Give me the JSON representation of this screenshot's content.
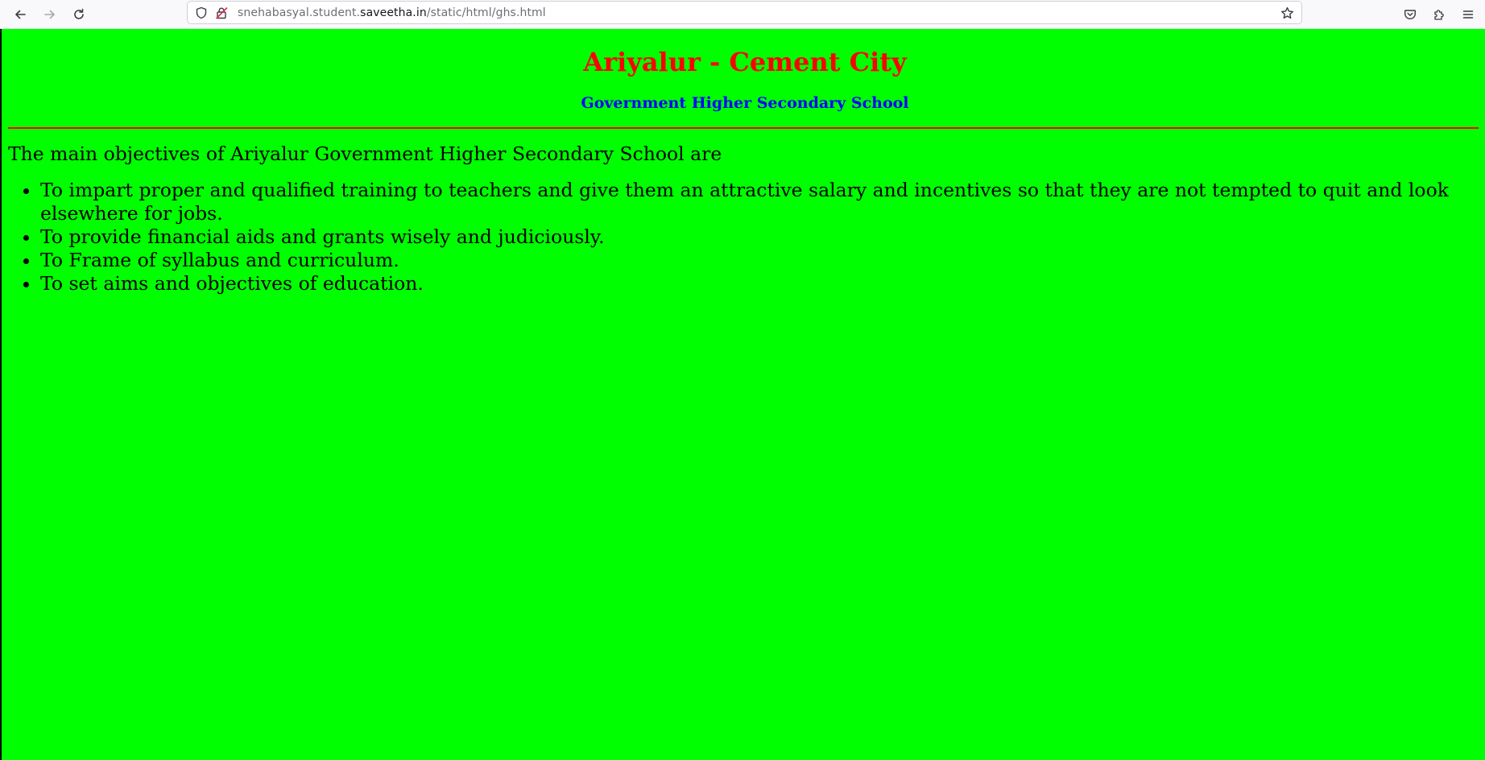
{
  "browser": {
    "url_prefix": "snehabasyal.student.",
    "url_domain": "saveetha.in",
    "url_path": "/static/html/ghs.html",
    "icons": {
      "back": "arrow-left-icon",
      "forward": "arrow-right-icon",
      "reload": "reload-icon",
      "site_info": "shield-icon",
      "connection": "insecure-lock-icon",
      "bookmark": "star-icon",
      "pocket": "pocket-icon",
      "extensions": "puzzle-icon",
      "menu": "hamburger-menu-icon"
    }
  },
  "page": {
    "background_color": "#00ff00",
    "heading": "Ariyalur - Cement City",
    "heading_color": "#ff0000",
    "subheading": "Government Higher Secondary School",
    "subheading_color": "#0000ff",
    "rule_color": "#ff0000",
    "intro": "The main objectives of Ariyalur Government Higher Secondary School are",
    "objectives": [
      "To impart proper and qualified training to teachers and give them an attractive salary and incentives so that they are not tempted to quit and look elsewhere for jobs.",
      "To provide financial aids and grants wisely and judiciously.",
      "To Frame of syllabus and curriculum.",
      "To set aims and objectives of education."
    ]
  }
}
